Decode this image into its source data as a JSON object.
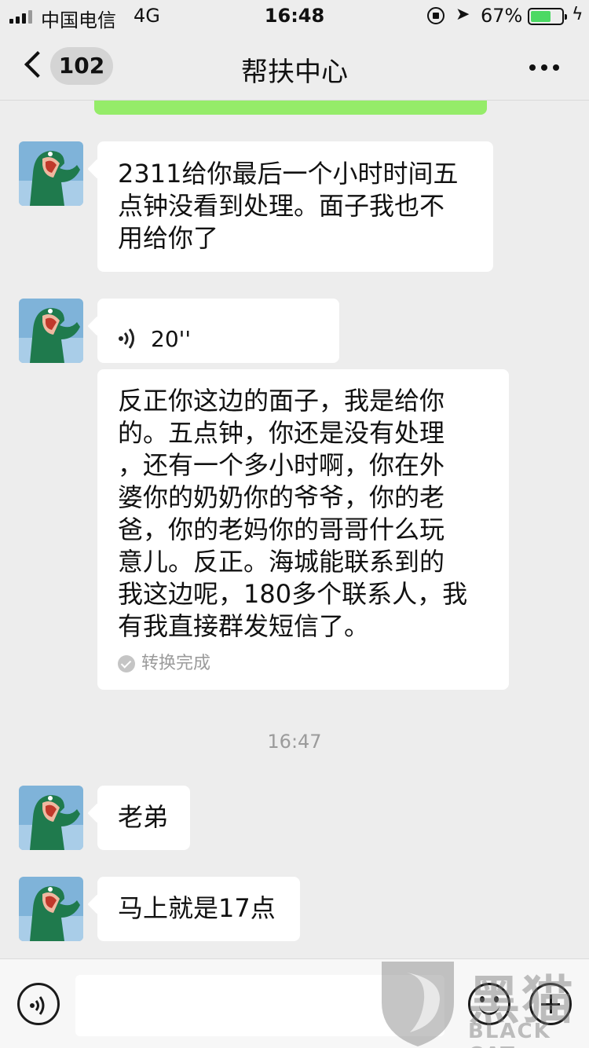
{
  "status_bar": {
    "carrier": "中国电信",
    "network": "4G",
    "time": "16:48",
    "battery_percent": "67%",
    "battery_level": 0.67
  },
  "nav": {
    "unread_count": "102",
    "title": "帮扶中心"
  },
  "messages": [
    {
      "type": "text",
      "lines": [
        "2311给你最后一个小时时间五",
        "点钟没看到处理。面子我也不",
        "用给你了"
      ]
    },
    {
      "type": "voice",
      "duration": "20''"
    },
    {
      "type": "voice-transcript",
      "lines": [
        "反正你这边的面子，我是给你",
        "的。五点钟，你还是没有处理",
        "，还有一个多小时啊，你在外",
        "婆你的奶奶你的爷爷，你的老",
        "爸，你的老妈你的哥哥什么玩",
        "意儿。反正。海城能联系到的",
        "我这边呢，180多个联系人，我",
        "有我直接群发短信了。"
      ],
      "status": "转换完成"
    },
    {
      "type": "timestamp",
      "text": "16:47"
    },
    {
      "type": "text",
      "lines": [
        "老弟"
      ]
    },
    {
      "type": "text",
      "lines": [
        "马上就是17点"
      ]
    }
  ],
  "watermark": {
    "cn": "黑猫",
    "en": "BLACK CAT"
  },
  "colors": {
    "background": "#ededed",
    "sent_bubble": "#95ec69",
    "received_bubble": "#ffffff",
    "battery": "#4cd964"
  }
}
